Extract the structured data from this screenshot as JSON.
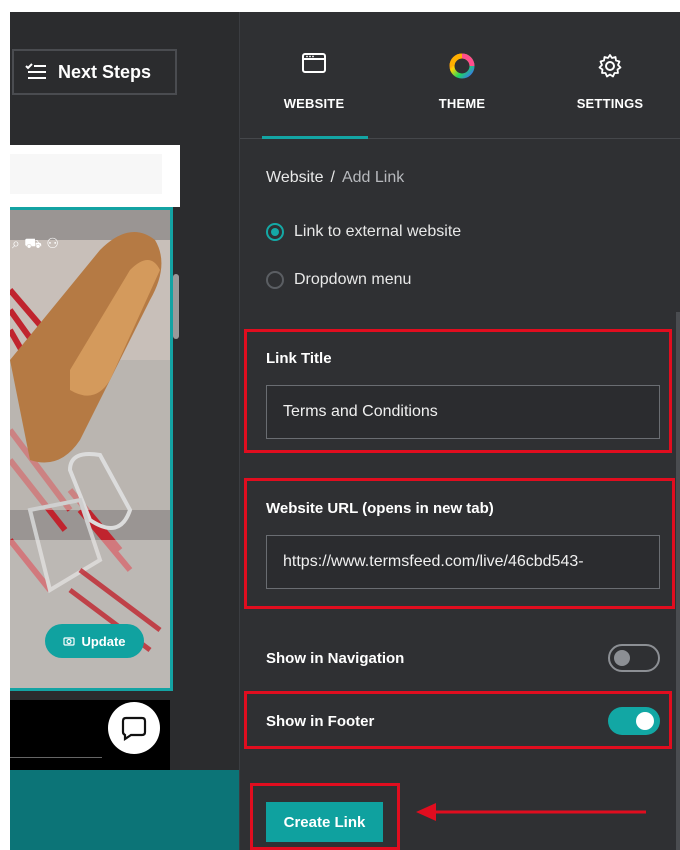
{
  "editor": {
    "next_steps_label": "Next Steps",
    "update_label": "Update"
  },
  "panel": {
    "tabs": [
      {
        "label": "WEBSITE",
        "icon": "browser-window-icon",
        "active": true
      },
      {
        "label": "THEME",
        "icon": "color-wheel-icon",
        "active": false
      },
      {
        "label": "SETTINGS",
        "icon": "gear-icon",
        "active": false
      }
    ],
    "breadcrumb": {
      "root": "Website",
      "separator": "/",
      "current": "Add Link"
    },
    "link_type": {
      "options": [
        {
          "label": "Link to external website",
          "selected": true
        },
        {
          "label": "Dropdown menu",
          "selected": false
        }
      ]
    },
    "link_title": {
      "label": "Link Title",
      "value": "Terms and Conditions"
    },
    "website_url": {
      "label": "Website URL (opens in new tab)",
      "value": "https://www.termsfeed.com/live/46cbd543-"
    },
    "show_in_navigation": {
      "label": "Show in Navigation",
      "on": false
    },
    "show_in_footer": {
      "label": "Show in Footer",
      "on": true
    },
    "create_link_label": "Create Link"
  },
  "colors": {
    "accent": "#13a4a4",
    "annotation_red": "#e10d1f",
    "panel_bg": "#2f3033"
  }
}
